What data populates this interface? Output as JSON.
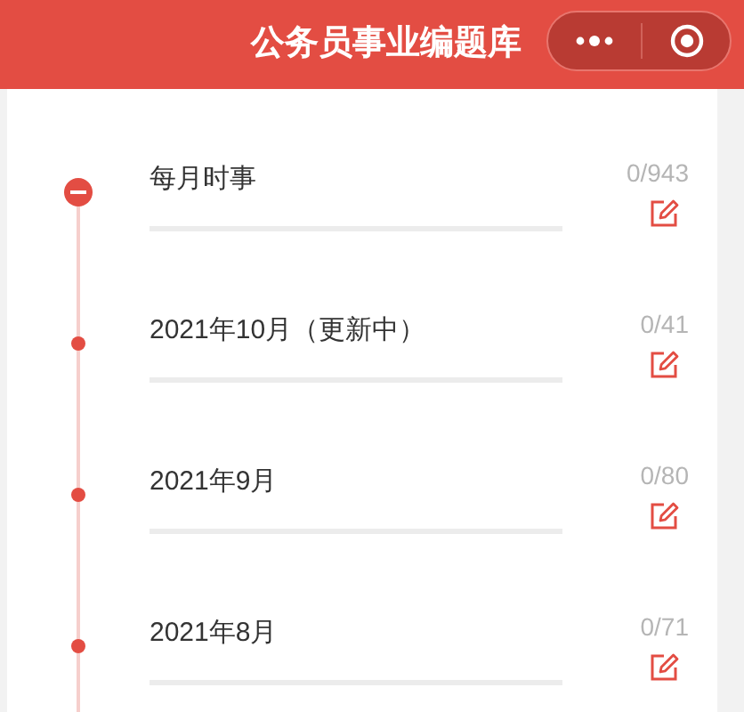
{
  "header": {
    "title": "公务员事业编题库"
  },
  "items": [
    {
      "title": "每月时事",
      "count": "0/943",
      "expanded": true
    },
    {
      "title": "2021年10月（更新中）",
      "count": "0/41",
      "expanded": false
    },
    {
      "title": "2021年9月",
      "count": "0/80",
      "expanded": false
    },
    {
      "title": "2021年8月",
      "count": "0/71",
      "expanded": false
    }
  ]
}
